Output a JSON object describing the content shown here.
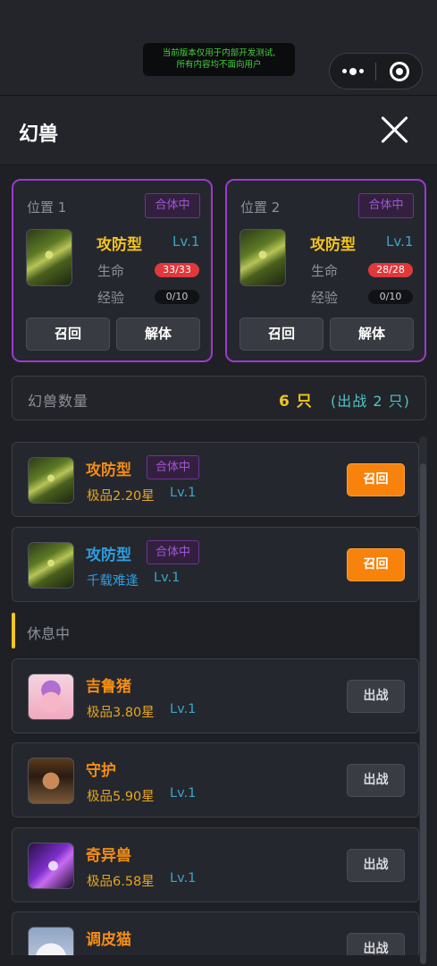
{
  "notice": {
    "line1": "当前版本仅用于内部开发测试,",
    "line2": "所有内容均不面向用户"
  },
  "header": {
    "title": "幻兽"
  },
  "slots": [
    {
      "position": "位置 1",
      "tag": "合体中",
      "name": "攻防型",
      "level": "Lv.1",
      "hp_label": "生命",
      "hp": "33/33",
      "exp_label": "经验",
      "exp": "0/10",
      "recall_label": "召回",
      "unmerge_label": "解体",
      "avatar_icon": "mantis-icon"
    },
    {
      "position": "位置 2",
      "tag": "合体中",
      "name": "攻防型",
      "level": "Lv.1",
      "hp_label": "生命",
      "hp": "28/28",
      "exp_label": "经验",
      "exp": "0/10",
      "recall_label": "召回",
      "unmerge_label": "解体",
      "avatar_icon": "mantis-icon"
    }
  ],
  "count": {
    "label": "幻兽数量",
    "total": "6 只",
    "in_battle": "(出战 2 只)"
  },
  "battle_list": [
    {
      "name": "攻防型",
      "tag": "合体中",
      "quality": "极品2.20星",
      "level": "Lv.1",
      "action": "召回",
      "name_color": "#f48d13",
      "avatar_icon": "mantis-icon"
    },
    {
      "name": "攻防型",
      "tag": "合体中",
      "quality": "千载难逢",
      "level": "Lv.1",
      "action": "召回",
      "name_color": "#2d9ddf",
      "avatar_icon": "mantis-icon"
    }
  ],
  "rest_section": {
    "title": "休息中"
  },
  "rest_list": [
    {
      "name": "吉鲁猪",
      "quality": "极品3.80星",
      "level": "Lv.1",
      "action": "出战",
      "avatar_icon": "pig-icon"
    },
    {
      "name": "守护",
      "quality": "极品5.90星",
      "level": "Lv.1",
      "action": "出战",
      "avatar_icon": "guardian-icon"
    },
    {
      "name": "奇异兽",
      "quality": "极品6.58星",
      "level": "Lv.1",
      "action": "出战",
      "avatar_icon": "beast-icon"
    },
    {
      "name": "调皮猫",
      "action": "出战",
      "avatar_icon": "cat-icon"
    }
  ]
}
